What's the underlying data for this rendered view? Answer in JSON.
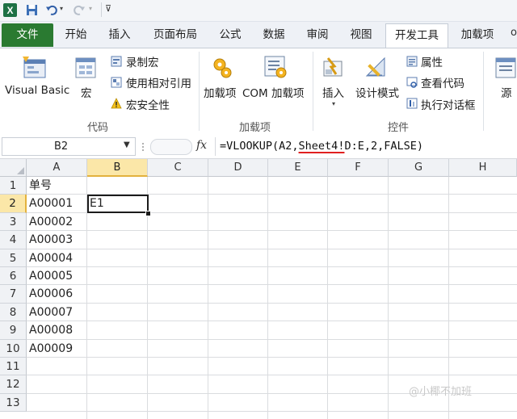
{
  "qat": {
    "icons": [
      "excel-logo-icon",
      "save-icon",
      "undo-icon",
      "undo-dropdown-icon",
      "redo-icon",
      "redo-dropdown-icon",
      "customize-qat-icon"
    ]
  },
  "tabs": [
    {
      "label": "文件",
      "state": "file"
    },
    {
      "label": "开始",
      "state": "normal"
    },
    {
      "label": "插入",
      "state": "normal"
    },
    {
      "label": "页面布局",
      "state": "normal"
    },
    {
      "label": "公式",
      "state": "normal"
    },
    {
      "label": "数据",
      "state": "normal"
    },
    {
      "label": "审阅",
      "state": "normal"
    },
    {
      "label": "视图",
      "state": "normal"
    },
    {
      "label": "开发工具",
      "state": "active"
    },
    {
      "label": "加载项",
      "state": "normal"
    }
  ],
  "ribbon": {
    "code_group": {
      "label": "代码",
      "visual_basic": "Visual Basic",
      "macros": "宏",
      "record_macro": "录制宏",
      "relative_ref": "使用相对引用",
      "macro_security": "宏安全性"
    },
    "addins_group": {
      "label": "加载项",
      "addins": "加载项",
      "com_addins": "COM 加载项"
    },
    "controls_group": {
      "label": "控件",
      "insert": "插入",
      "design_mode": "设计模式",
      "properties": "属性",
      "view_code": "查看代码",
      "run_dialog": "执行对话框"
    },
    "source_cut": "源"
  },
  "formula_bar": {
    "name_box": "B2",
    "fx": "fx",
    "formula": "=VLOOKUP(A2,Sheet4!D:E,2,FALSE)",
    "formula_parts": [
      "=VLOOKUP(A2,",
      "Sheet4!",
      "D:E,2,FALSE)"
    ]
  },
  "sheet": {
    "columns": [
      "A",
      "B",
      "C",
      "D",
      "E",
      "F",
      "G",
      "H"
    ],
    "rows": [
      "1",
      "2",
      "3",
      "4",
      "5",
      "6",
      "7",
      "8",
      "9",
      "10",
      "11",
      "12",
      "13"
    ],
    "active_col": "B",
    "active_row": "2",
    "cells": {
      "A1": "单号",
      "A2": "A00001",
      "A3": "A00002",
      "A4": "A00003",
      "A5": "A00004",
      "A6": "A00005",
      "A7": "A00006",
      "A8": "A00007",
      "A9": "A00008",
      "A10": "A00009",
      "B2": "E1"
    }
  },
  "watermark": "@小椰不加班",
  "colors": {
    "file_tab": "#2a7a31",
    "active_header": "#fbe7a8",
    "underline": "#e02020"
  }
}
